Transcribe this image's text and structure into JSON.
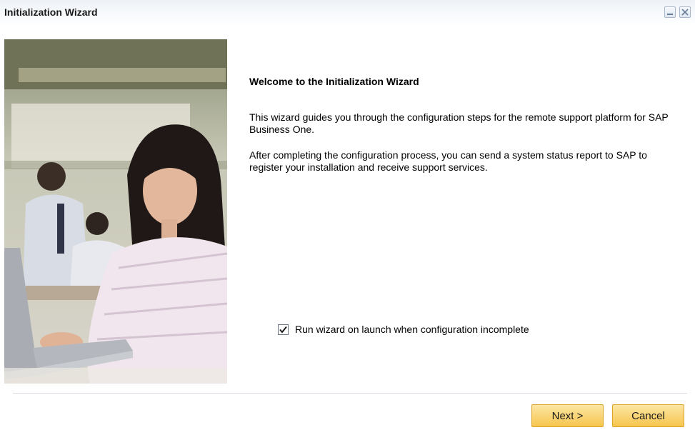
{
  "window": {
    "title": "Initialization Wizard",
    "minimize_icon": "minimize-icon",
    "close_icon": "close-icon"
  },
  "content": {
    "heading": "Welcome to the Initialization Wizard",
    "paragraph1": "This wizard guides you through the configuration steps for the remote support platform for SAP Business One.",
    "paragraph2": "After completing the configuration process, you can send a system status report to SAP to register your installation and receive support services."
  },
  "options": {
    "run_on_launch": {
      "label": "Run wizard on launch when configuration incomplete",
      "checked": true
    }
  },
  "buttons": {
    "next": "Next >",
    "cancel": "Cancel"
  },
  "colors": {
    "button_fill": "#f6c54d",
    "button_border": "#d9a52b"
  }
}
